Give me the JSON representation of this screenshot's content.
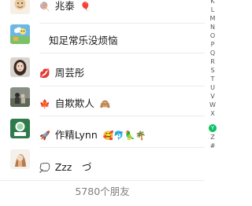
{
  "contacts": [
    {
      "prefix": "🍭",
      "name": "兆泰",
      "suffix": "🎈"
    },
    {
      "prefix": "",
      "name": "知足常乐没烦恼",
      "suffix": ""
    },
    {
      "prefix": "💋",
      "name": "周芸彤",
      "suffix": ""
    },
    {
      "prefix": "🍁",
      "name": "自欺欺人",
      "suffix": "🙈"
    },
    {
      "prefix": "🚀",
      "name": "作精Lynn",
      "suffix": "🥰🐬🦜🌴"
    },
    {
      "prefix": "💭",
      "name": "Zzz　づ",
      "suffix": ""
    }
  ],
  "footer": {
    "count_text": "5780个朋友"
  },
  "index": {
    "letters": [
      "K",
      "L",
      "M",
      "N",
      "O",
      "P",
      "Q",
      "R",
      "S",
      "T",
      "U",
      "V",
      "W",
      "X",
      "Z",
      "#"
    ],
    "active_letter": "Y",
    "active_color": "#07c160"
  }
}
